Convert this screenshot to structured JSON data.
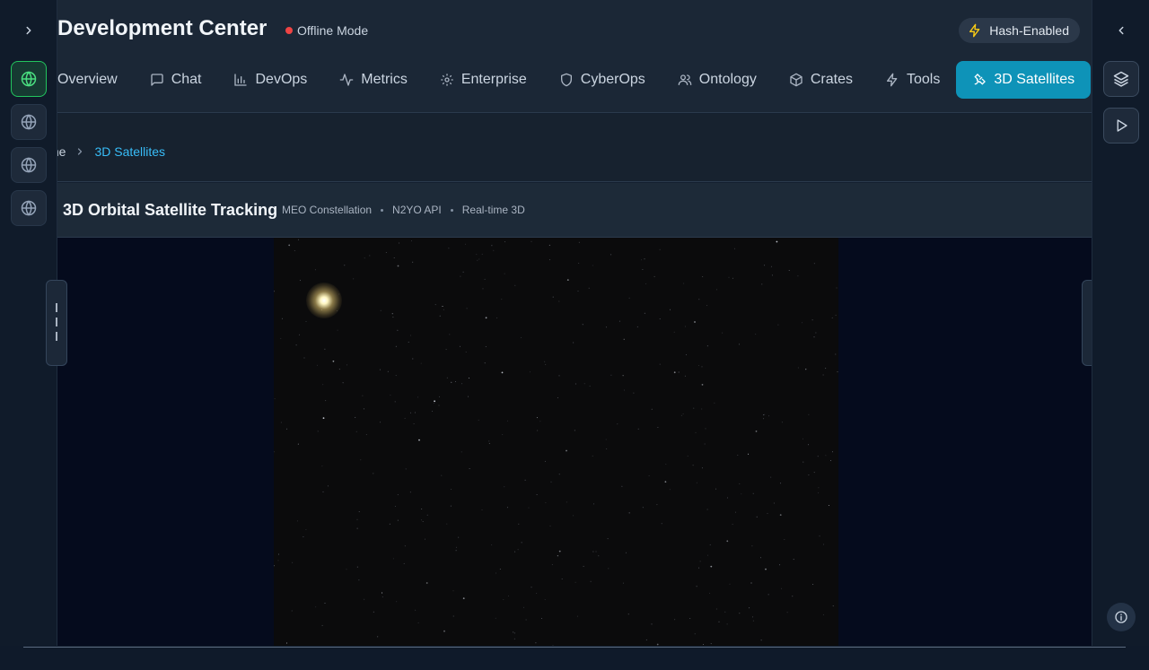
{
  "app": {
    "title": "Development Center",
    "status_label": "Offline Mode",
    "hash_badge": "Hash-Enabled"
  },
  "tabs": [
    {
      "label": "Overview",
      "icon": "none"
    },
    {
      "label": "Chat",
      "icon": "chat-bubble-icon"
    },
    {
      "label": "DevOps",
      "icon": "bar-chart-icon"
    },
    {
      "label": "Metrics",
      "icon": "activity-icon"
    },
    {
      "label": "Enterprise",
      "icon": "gear-icon"
    },
    {
      "label": "CyberOps",
      "icon": "shield-icon"
    },
    {
      "label": "Ontology",
      "icon": "users-icon"
    },
    {
      "label": "Crates",
      "icon": "package-icon"
    },
    {
      "label": "Tools",
      "icon": "bolt-icon"
    },
    {
      "label": "3D Satellites",
      "icon": "satellite-icon",
      "active": true
    }
  ],
  "breadcrumb": {
    "home": "me",
    "current": "3D Satellites"
  },
  "panel": {
    "title": "3D Orbital Satellite Tracking",
    "meta": [
      "MEO Constellation",
      "N2YO API",
      "Real-time 3D"
    ]
  },
  "left_rail": {
    "items": [
      "globe-icon",
      "globe-icon",
      "globe-icon",
      "globe-icon"
    ],
    "active_index": 0
  },
  "right_rail": {
    "items": [
      "layers-icon",
      "play-icon",
      "info-icon"
    ]
  },
  "colors": {
    "accent": "#0e93b8",
    "active_rail": "#22c55e",
    "status_offline": "#ef4444",
    "breadcrumb_current": "#38bdf8",
    "badge_bolt": "#facc15"
  }
}
